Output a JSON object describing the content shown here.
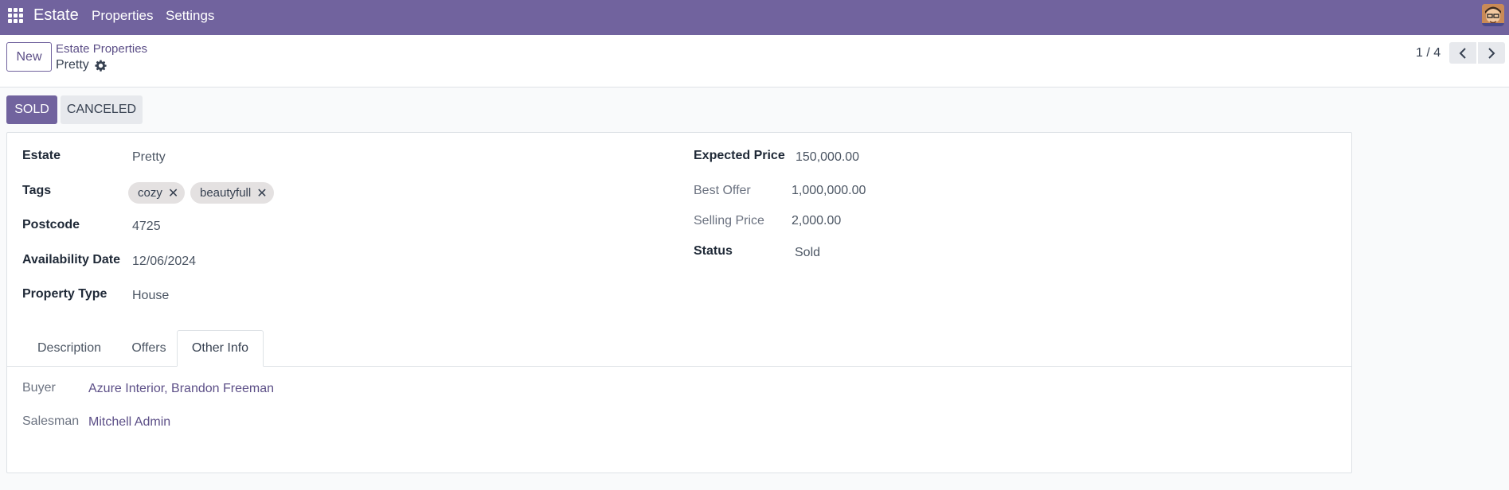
{
  "navbar": {
    "brand": "Estate",
    "menu": [
      "Properties",
      "Settings"
    ],
    "icons": {
      "apps": "apps-grid-icon",
      "avatar": "user-avatar"
    }
  },
  "control_panel": {
    "new_label": "New",
    "breadcrumb": "Estate Properties",
    "record_name": "Pretty",
    "pager": "1 / 4"
  },
  "status_buttons": {
    "sold": "SOLD",
    "canceled": "CANCELED"
  },
  "form": {
    "left": {
      "estate_label": "Estate",
      "estate_value": "Pretty",
      "tags_label": "Tags",
      "tags": [
        "cozy",
        "beautyfull"
      ],
      "postcode_label": "Postcode",
      "postcode_value": "4725",
      "availability_label": "Availability Date",
      "availability_value": "12/06/2024",
      "property_type_label": "Property Type",
      "property_type_value": "House"
    },
    "right": {
      "expected_price_label": "Expected Price",
      "expected_price_value": "150,000.00",
      "best_offer_label": "Best Offer",
      "best_offer_value": "1,000,000.00",
      "selling_price_label": "Selling Price",
      "selling_price_value": "2,000.00",
      "status_label": "Status",
      "status_value": "Sold"
    },
    "tabs": [
      {
        "label": "Description",
        "active": false
      },
      {
        "label": "Offers",
        "active": false
      },
      {
        "label": "Other Info",
        "active": true
      }
    ],
    "other_info": {
      "buyer_label": "Buyer",
      "buyer_value": "Azure Interior, Brandon Freeman",
      "salesman_label": "Salesman",
      "salesman_value": "Mitchell Admin"
    }
  },
  "colors": {
    "navbar": "#71639e",
    "primary": "#71639e",
    "link": "#5c4f87"
  }
}
